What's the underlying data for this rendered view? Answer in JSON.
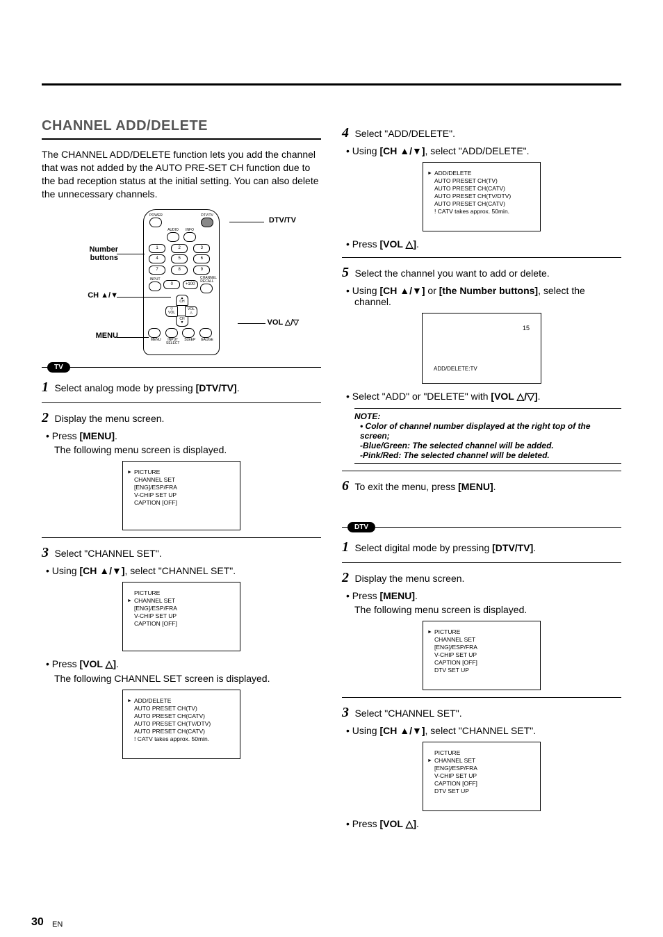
{
  "page_number": "30",
  "page_lang": "EN",
  "title": "CHANNEL ADD/DELETE",
  "intro": "The CHANNEL ADD/DELETE function lets you add the channel that was not added by the AUTO PRE-SET CH function due to the bad reception status at the initial setting. You can also delete the unnecessary channels.",
  "remote": {
    "callouts": {
      "dtvtv": "DTV/TV",
      "number": "Number buttons",
      "chud": "CH ▲/▼",
      "menu": "MENU",
      "vol": "VOL △/▽"
    },
    "small": {
      "power": "POWER",
      "dtvtv": "DTV/TV",
      "audio": "AUDIO",
      "info": "INFO",
      "input": "INPUT",
      "ch_recall": "CHANNEL RECALL",
      "plus100": "+100",
      "vol_minus": "VOL",
      "vol_plus": "VOL",
      "ch_up": "CH",
      "ch_down": "CH",
      "menu": "MENU",
      "input_select": "INPUT SELECT",
      "sleep": "SLEEP",
      "gauge": "GAUGE"
    }
  },
  "badges": {
    "tv": "TV",
    "dtv": "DTV"
  },
  "left": {
    "step1": {
      "text_a": "Select analog mode by pressing ",
      "btn": "[DTV/TV]",
      "text_b": "."
    },
    "step2": {
      "text": "Display the menu screen.",
      "bullet_a": "Press ",
      "bullet_btn": "[MENU]",
      "bullet_b": ".",
      "sub": "The following menu screen is displayed."
    },
    "osd1": {
      "items": [
        "PICTURE",
        "CHANNEL SET",
        "[ENG]/ESP/FRA",
        "V-CHIP SET UP",
        "CAPTION [OFF]"
      ],
      "pointer_index": 0
    },
    "step3": {
      "text": "Select \"CHANNEL SET\".",
      "bullet_a": "Using ",
      "bullet_btn": "[CH ▲/▼]",
      "bullet_b": ", select \"CHANNEL SET\"."
    },
    "osd2": {
      "items": [
        "PICTURE",
        "CHANNEL SET",
        "[ENG]/ESP/FRA",
        "V-CHIP SET UP",
        "CAPTION [OFF]"
      ],
      "pointer_index": 1
    },
    "step3_press": {
      "a": "Press ",
      "btn": "[VOL △]",
      "b": ".",
      "sub": "The following CHANNEL SET screen is displayed."
    },
    "osd3": {
      "items": [
        "ADD/DELETE",
        "AUTO PRESET CH(TV)",
        "AUTO PRESET CH(CATV)",
        "AUTO PRESET CH(TV/DTV)",
        "AUTO PRESET CH(CATV)",
        "! CATV takes approx. 50min."
      ],
      "pointer_index": 0
    }
  },
  "right": {
    "step4": {
      "text": "Select \"ADD/DELETE\".",
      "bullet_a": "Using ",
      "bullet_btn": "[CH ▲/▼]",
      "bullet_b": ", select \"ADD/DELETE\"."
    },
    "osd4": {
      "items": [
        "ADD/DELETE",
        "AUTO PRESET CH(TV)",
        "AUTO PRESET CH(CATV)",
        "AUTO PRESET CH(TV/DTV)",
        "AUTO PRESET CH(CATV)",
        "! CATV takes approx. 50min."
      ],
      "pointer_index": 0
    },
    "step4_press": {
      "a": "Press ",
      "btn": "[VOL △]",
      "b": "."
    },
    "step5": {
      "text": "Select the channel you want to add or delete.",
      "bullet_a": "Using ",
      "bullet_btn1": "[CH ▲/▼]",
      "bullet_mid": " or ",
      "bullet_btn2": "[the Number buttons]",
      "bullet_b": ", select the channel."
    },
    "osd_ch": {
      "num": "15",
      "label": "ADD/DELETE:TV"
    },
    "step5_select": {
      "a": "Select \"ADD\" or \"DELETE\" with ",
      "btn": "[VOL △/▽]",
      "b": "."
    },
    "note": {
      "title": "NOTE:",
      "l1": "Color of channel number displayed at the right top of the screen;",
      "l2": "-Blue/Green: The selected channel will be added.",
      "l3": "-Pink/Red: The selected channel will be deleted."
    },
    "step6": {
      "a": "To exit the menu, press ",
      "btn": "[MENU]",
      "b": "."
    },
    "dtv_step1": {
      "a": "Select digital mode by pressing ",
      "btn": "[DTV/TV]",
      "b": "."
    },
    "dtv_step2": {
      "text": "Display the menu screen.",
      "bullet_a": "Press ",
      "bullet_btn": "[MENU]",
      "bullet_b": ".",
      "sub": "The following menu screen is displayed."
    },
    "osd_dtv1": {
      "items": [
        "PICTURE",
        "CHANNEL SET",
        "[ENG]/ESP/FRA",
        "V-CHIP SET UP",
        "CAPTION [OFF]",
        "DTV SET UP"
      ],
      "pointer_index": 0
    },
    "dtv_step3": {
      "text": "Select \"CHANNEL SET\".",
      "bullet_a": "Using ",
      "bullet_btn": "[CH ▲/▼]",
      "bullet_b": ", select \"CHANNEL SET\"."
    },
    "osd_dtv2": {
      "items": [
        "PICTURE",
        "CHANNEL SET",
        "[ENG]/ESP/FRA",
        "V-CHIP SET UP",
        "CAPTION [OFF]",
        "DTV SET UP"
      ],
      "pointer_index": 1
    },
    "dtv_press": {
      "a": "Press ",
      "btn": "[VOL △]",
      "b": "."
    }
  }
}
